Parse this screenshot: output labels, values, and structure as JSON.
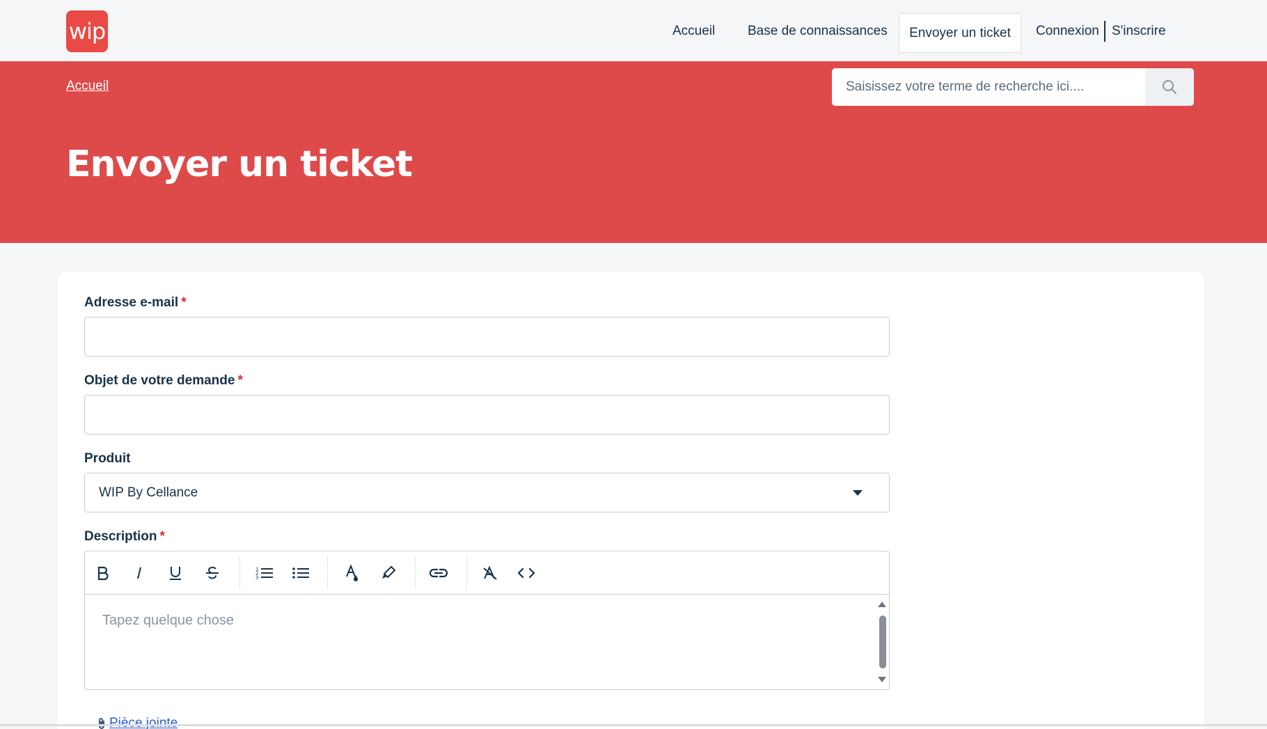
{
  "header": {
    "logo_text": "wip",
    "nav": {
      "home": "Accueil",
      "knowledge_base": "Base de connaissances",
      "submit_ticket": "Envoyer un ticket",
      "login": "Connexion",
      "signup": "S'inscrire"
    }
  },
  "hero": {
    "breadcrumb": "Accueil",
    "search_placeholder": "Saisissez votre terme de recherche ici....",
    "title": "Envoyer un ticket"
  },
  "form": {
    "email_label": "Adresse e-mail",
    "subject_label": "Objet de votre demande",
    "product_label": "Produit",
    "product_value": "WIP By Cellance",
    "description_label": "Description",
    "required_mark": "*",
    "description_placeholder": "Tapez quelque chose",
    "attachment_label": "Pièce jointe"
  },
  "toolbar": {
    "icons": [
      "bold-icon",
      "italic-icon",
      "underline-icon",
      "strikethrough-icon",
      "ordered-list-icon",
      "unordered-list-icon",
      "font-color-icon",
      "highlight-icon",
      "link-icon",
      "clear-format-icon",
      "code-icon"
    ]
  },
  "colors": {
    "brand": "#e94a45",
    "hero_bg": "#de4a4a",
    "text": "#183247",
    "required": "#d72d30",
    "link": "#2c5cc5"
  }
}
